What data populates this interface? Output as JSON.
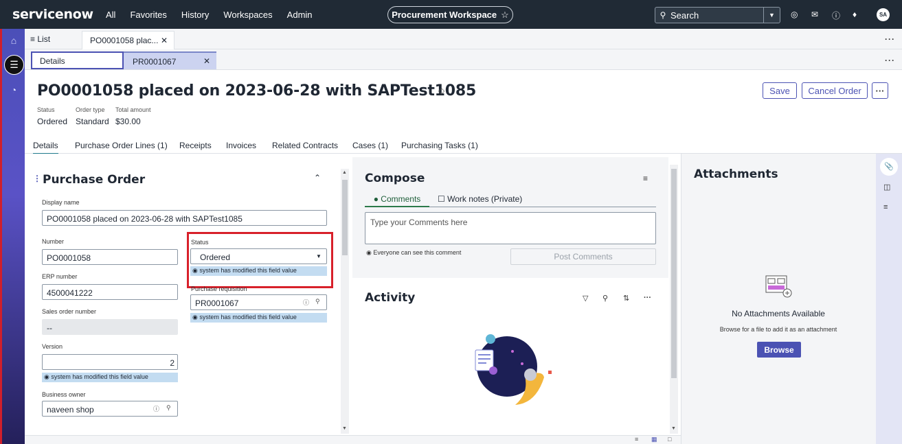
{
  "topnav": {
    "logo": "servicenow",
    "menu": [
      "All",
      "Favorites",
      "History",
      "Workspaces",
      "Admin"
    ],
    "workspace": "Procurement Workspace",
    "search_label": "Search",
    "avatar": "SA"
  },
  "tabs": {
    "list": "List",
    "record": "PO0001058 plac...",
    "sub_details": "Details",
    "sub_pr": "PR0001067"
  },
  "record": {
    "title": "PO0001058 placed on 2023-06-28 with SAPTest1085",
    "meta": [
      {
        "label": "Status",
        "value": "Ordered"
      },
      {
        "label": "Order type",
        "value": "Standard"
      },
      {
        "label": "Total amount",
        "value": "$30.00"
      }
    ],
    "save_label": "Save",
    "cancel_label": "Cancel Order",
    "more_label": "···"
  },
  "section_tabs": [
    "Details",
    "Purchase Order Lines (1)",
    "Receipts",
    "Invoices",
    "Related Contracts",
    "Cases (1)",
    "Purchasing Tasks (1)"
  ],
  "form": {
    "section_title": "Purchase Order",
    "display_name_label": "Display name",
    "display_name": "PO0001058 placed on 2023-06-28 with SAPTest1085",
    "number_label": "Number",
    "number": "PO0001058",
    "erp_label": "ERP number",
    "erp": "4500041222",
    "sales_order_label": "Sales order number",
    "sales_order": "--",
    "version_label": "Version",
    "version": "2",
    "business_owner_label": "Business owner",
    "business_owner": "naveen shop",
    "status_label": "Status",
    "status": "Ordered",
    "purchase_req_label": "Purchase requisition",
    "purchase_req": "PR0001067",
    "mod_note": "system has modified this field value"
  },
  "compose": {
    "title": "Compose",
    "tab_comments": "Comments",
    "tab_worknotes": "Work notes (Private)",
    "placeholder": "Type your Comments here",
    "everyone": "Everyone can see this comment",
    "post_label": "Post Comments"
  },
  "activity": {
    "title": "Activity"
  },
  "attachments": {
    "title": "Attachments",
    "empty": "No Attachments Available",
    "hint": "Browse for a file to add it as an attachment",
    "browse_label": "Browse"
  },
  "colors": {
    "nav_bg": "#202a35",
    "accent": "#4b52b3",
    "mod_note_bg": "#c3dcf1",
    "highlight": "#d8202a"
  }
}
